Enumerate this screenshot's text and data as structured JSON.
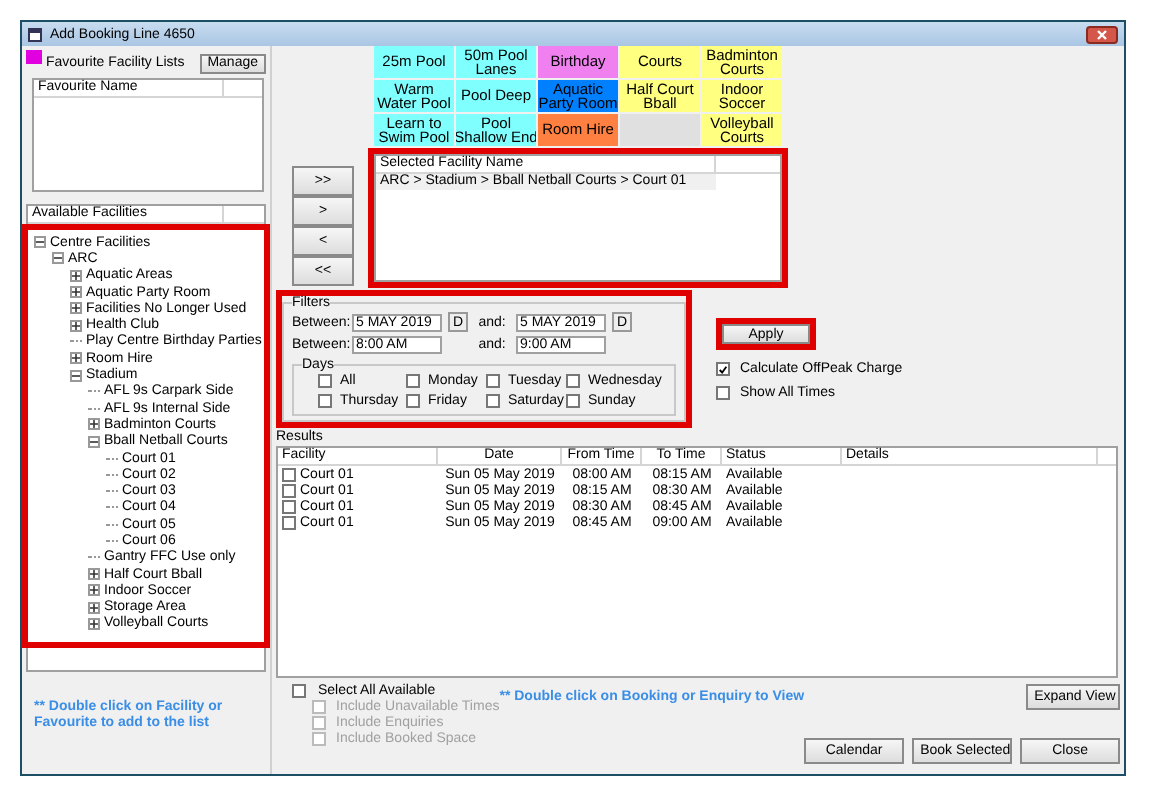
{
  "window": {
    "title": "Add Booking Line 4650"
  },
  "favourites": {
    "label": "Favourite Facility Lists",
    "manage_button": "Manage",
    "columns": [
      "Favourite Name"
    ]
  },
  "available": {
    "label": "Available Facilities",
    "tree": [
      {
        "label": "Centre Facilities",
        "expanded": true,
        "children": [
          {
            "label": "ARC",
            "expanded": true,
            "children": [
              {
                "label": "Aquatic Areas",
                "expanded": false
              },
              {
                "label": "Aquatic Party Room",
                "expanded": false
              },
              {
                "label": "Facilities No Longer Used",
                "expanded": false
              },
              {
                "label": "Health Club",
                "expanded": false
              },
              {
                "label": "Play Centre Birthday Parties"
              },
              {
                "label": "Room Hire",
                "expanded": false
              },
              {
                "label": "Stadium",
                "expanded": true,
                "children": [
                  {
                    "label": "AFL 9s Carpark Side"
                  },
                  {
                    "label": "AFL 9s Internal Side"
                  },
                  {
                    "label": "Badminton Courts",
                    "expanded": false
                  },
                  {
                    "label": "Bball Netball Courts",
                    "expanded": true,
                    "children": [
                      {
                        "label": "Court 01"
                      },
                      {
                        "label": "Court 02"
                      },
                      {
                        "label": "Court 03"
                      },
                      {
                        "label": "Court 04"
                      },
                      {
                        "label": "Court 05"
                      },
                      {
                        "label": "Court 06"
                      }
                    ]
                  },
                  {
                    "label": "Gantry FFC Use only"
                  },
                  {
                    "label": "Half Court Bball",
                    "expanded": false
                  },
                  {
                    "label": "Indoor Soccer",
                    "expanded": false
                  },
                  {
                    "label": "Storage Area",
                    "expanded": false
                  },
                  {
                    "label": "Volleyball Courts",
                    "expanded": false
                  }
                ]
              }
            ]
          }
        ]
      }
    ]
  },
  "left_note": "** Double click on Facility or Favourite to add to the list",
  "move_buttons": [
    ">>",
    ">",
    "<",
    "<<"
  ],
  "facility_tiles": [
    {
      "kind": "tile",
      "lines": [
        "25m Pool"
      ],
      "color": "#80ffff"
    },
    {
      "kind": "tile",
      "lines": [
        "50m Pool",
        "Lanes"
      ],
      "color": "#80ffff"
    },
    {
      "kind": "tile",
      "lines": [
        "Birthday"
      ],
      "color": "#f080f0"
    },
    {
      "kind": "tile",
      "lines": [
        "Courts"
      ],
      "color": "#ffff80"
    },
    {
      "kind": "tile",
      "lines": [
        "Badminton",
        "Courts"
      ],
      "color": "#ffff80"
    },
    {
      "kind": "tile",
      "lines": [
        "Warm",
        "Water Pool"
      ],
      "color": "#80ffff"
    },
    {
      "kind": "tile",
      "lines": [
        "Pool Deep"
      ],
      "color": "#80ffff"
    },
    {
      "kind": "tile",
      "lines": [
        "Aquatic",
        "Party Room"
      ],
      "color": "#0080ff"
    },
    {
      "kind": "tile",
      "lines": [
        "Half Court",
        "Bball"
      ],
      "color": "#ffff80"
    },
    {
      "kind": "tile",
      "lines": [
        "Indoor",
        "Soccer"
      ],
      "color": "#ffff80"
    },
    {
      "kind": "tile",
      "lines": [
        "Learn to",
        "Swim Pool"
      ],
      "color": "#80ffff"
    },
    {
      "kind": "tile",
      "lines": [
        "Pool",
        "Shallow End"
      ],
      "color": "#80ffff"
    },
    {
      "kind": "tile",
      "lines": [
        "Room Hire"
      ],
      "color": "#ff8040"
    },
    {
      "kind": "empty"
    },
    {
      "kind": "tile",
      "lines": [
        "Volleyball",
        "Courts"
      ],
      "color": "#ffff80"
    }
  ],
  "selected_facilities": {
    "columns": [
      "Selected Facility Name"
    ],
    "rows": [
      "ARC > Stadium > Bball Netball Courts > Court 01"
    ]
  },
  "filters": {
    "label": "Filters",
    "ranges": [
      {
        "label": "Between:",
        "from": "5 MAY 2019",
        "from_picker": "D",
        "and_label": "and:",
        "to": "5 MAY 2019",
        "to_picker": "D"
      },
      {
        "label": "Between:",
        "from": "8:00 AM",
        "and_label": "and:",
        "to": "9:00 AM"
      }
    ],
    "days_label": "Days",
    "days": [
      {
        "label": "All",
        "checked": false
      },
      {
        "label": "Monday",
        "checked": false
      },
      {
        "label": "Tuesday",
        "checked": false
      },
      {
        "label": "Wednesday",
        "checked": false
      },
      {
        "label": "Thursday",
        "checked": false
      },
      {
        "label": "Friday",
        "checked": false
      },
      {
        "label": "Saturday",
        "checked": false
      },
      {
        "label": "Sunday",
        "checked": false
      }
    ]
  },
  "apply_button": "Apply",
  "options": [
    {
      "label": "Calculate OffPeak Charge",
      "checked": true
    },
    {
      "label": "Show All Times",
      "checked": false
    }
  ],
  "results": {
    "label": "Results",
    "columns": [
      "Facility",
      "Date",
      "From Time",
      "To Time",
      "Status",
      "Details"
    ],
    "rows": [
      {
        "checked": false,
        "cells": [
          "Court 01",
          "Sun 05 May 2019",
          "08:00 AM",
          "08:15 AM",
          "Available"
        ]
      },
      {
        "checked": false,
        "cells": [
          "Court 01",
          "Sun 05 May 2019",
          "08:15 AM",
          "08:30 AM",
          "Available"
        ]
      },
      {
        "checked": false,
        "cells": [
          "Court 01",
          "Sun 05 May 2019",
          "08:30 AM",
          "08:45 AM",
          "Available"
        ]
      },
      {
        "checked": false,
        "cells": [
          "Court 01",
          "Sun 05 May 2019",
          "08:45 AM",
          "09:00 AM",
          "Available"
        ]
      }
    ]
  },
  "select_all": {
    "label": "Select All Available",
    "checked": false,
    "sub_options": [
      {
        "label": "Include Unavailable Times",
        "checked": false,
        "disabled": true
      },
      {
        "label": "Include Enquiries",
        "checked": false,
        "disabled": true
      },
      {
        "label": "Include Booked Space",
        "checked": false,
        "disabled": true
      }
    ]
  },
  "results_note": "** Double click on Booking or Enquiry to View",
  "expand_button": "Expand View",
  "buttons": [
    "Calendar",
    "Book Selected",
    "Close"
  ]
}
